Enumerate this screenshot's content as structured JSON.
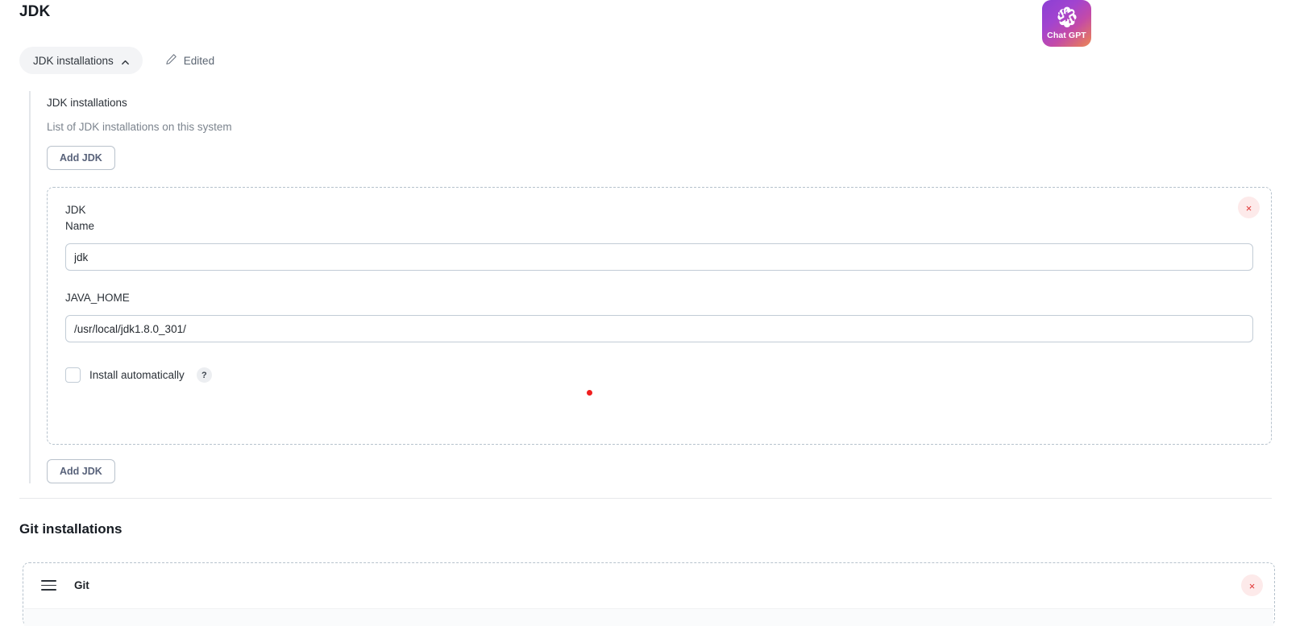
{
  "page": {
    "title": "JDK"
  },
  "badge": {
    "name": "chatgpt-badge",
    "text": "Chat GPT"
  },
  "toolbar": {
    "collapse_chip_label": "JDK installations",
    "caret_icon": "chevron-up-icon",
    "pencil_icon": "pencil-icon",
    "edited_label": "Edited"
  },
  "jdk_section": {
    "label": "JDK installations",
    "description": "List of JDK installations on this system",
    "add_button_top": "Add JDK",
    "add_button_bottom": "Add JDK",
    "remove_icon": "×",
    "entry": {
      "title_line1": "JDK",
      "title_line2": "Name",
      "name_value": "jdk",
      "name_placeholder": "",
      "java_home_label": "JAVA_HOME",
      "java_home_value": "/usr/local/jdk1.8.0_301/",
      "java_home_placeholder": "",
      "install_automatically_label": "Install automatically",
      "install_automatically_checked": false,
      "help_badge": "?"
    }
  },
  "git_section": {
    "heading": "Git installations",
    "row_label": "Git",
    "drag_handle_icon": "drag-handle-icon",
    "remove_icon": "×"
  },
  "colors": {
    "accent_red": "#e03030",
    "chip_bg": "#f3f4f6",
    "dashed_border": "#b6c2cc",
    "cursor_dot": "#f01e1e"
  }
}
